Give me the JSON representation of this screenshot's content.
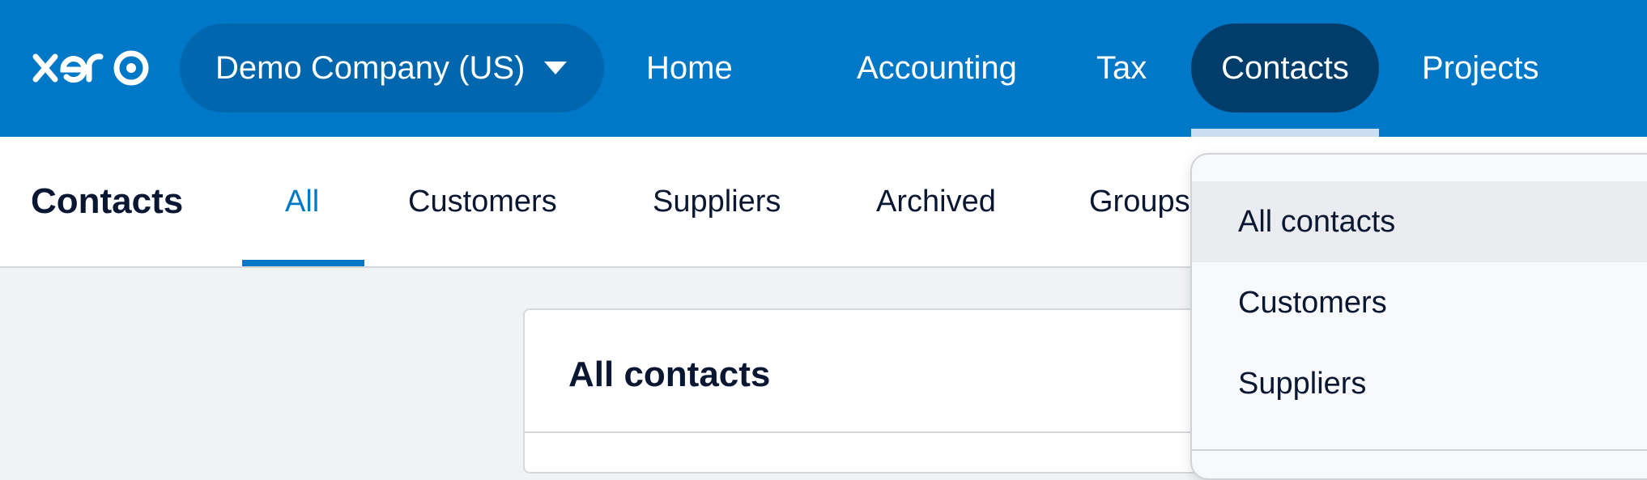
{
  "app": {
    "logo_text": "xero",
    "brand_color": "#0078c8",
    "active_nav_color": "#003d6b"
  },
  "topnav": {
    "org_name": "Demo Company (US)",
    "items": [
      {
        "label": "Home"
      },
      {
        "label": "Accounting"
      },
      {
        "label": "Tax"
      },
      {
        "label": "Contacts",
        "active": true
      },
      {
        "label": "Projects"
      }
    ]
  },
  "subnav": {
    "page_title": "Contacts",
    "tabs": [
      {
        "label": "All",
        "active": true
      },
      {
        "label": "Customers"
      },
      {
        "label": "Suppliers"
      },
      {
        "label": "Archived"
      },
      {
        "label": "Groups"
      }
    ]
  },
  "main": {
    "card_title": "All contacts"
  },
  "dropdown": {
    "items": [
      {
        "label": "All contacts",
        "highlighted": true
      },
      {
        "label": "Customers"
      },
      {
        "label": "Suppliers"
      }
    ]
  }
}
